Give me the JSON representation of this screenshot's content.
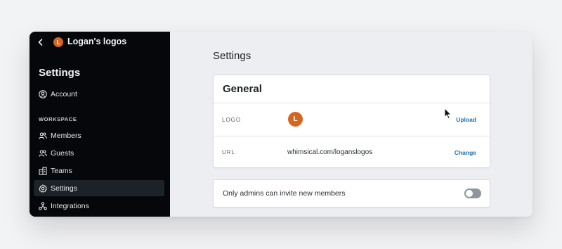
{
  "workspace": {
    "avatar_letter": "L",
    "name": "Logan's logos",
    "avatar_color": "#d4661f"
  },
  "sidebar": {
    "title": "Settings",
    "account_label": "Account",
    "section_label": "WORKSPACE",
    "items": [
      {
        "label": "Members",
        "icon": "members-icon"
      },
      {
        "label": "Guests",
        "icon": "guests-icon"
      },
      {
        "label": "Teams",
        "icon": "teams-icon"
      },
      {
        "label": "Settings",
        "icon": "gear-icon",
        "active": true
      },
      {
        "label": "Integrations",
        "icon": "integrations-icon"
      }
    ]
  },
  "main": {
    "title": "Settings",
    "general": {
      "heading": "General",
      "logo": {
        "label": "LOGO",
        "avatar_letter": "L",
        "action": "Upload"
      },
      "url": {
        "label": "URL",
        "value": "whimsical.com/loganslogos",
        "action": "Change"
      }
    },
    "invite": {
      "label": "Only admins can invite new members",
      "toggle_on": false
    }
  },
  "colors": {
    "sidebar_bg": "#05070a",
    "accent_link": "#1a6fb3",
    "toggle_off": "#8e959d"
  }
}
